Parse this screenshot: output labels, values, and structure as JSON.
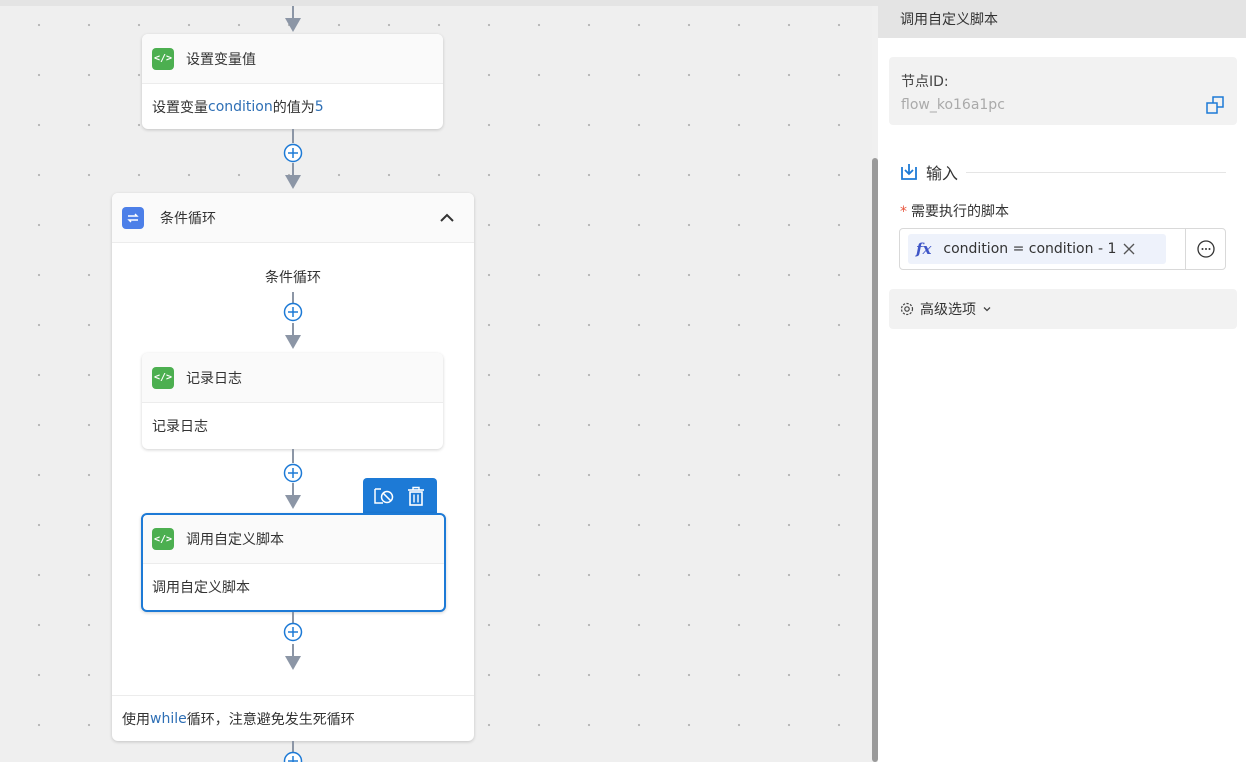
{
  "canvas": {
    "node_set_var": {
      "title": "设置变量值",
      "icon": "code-icon",
      "body_prefix": "设置变量 ",
      "body_var": "condition",
      "body_mid": " 的值为 ",
      "body_value": "5"
    },
    "loop": {
      "title": "条件循环",
      "icon": "loop-icon",
      "label": "条件循环",
      "footer_prefix": "使用 ",
      "footer_keyword": "while",
      "footer_suffix": " 循环，注意避免发生死循环"
    },
    "node_log": {
      "title": "记录日志",
      "icon": "code-icon",
      "body": "记录日志"
    },
    "node_script": {
      "title": "调用自定义脚本",
      "icon": "code-icon",
      "body": "调用自定义脚本"
    },
    "colors": {
      "accent": "#1d7ad6",
      "code_icon": "#4caf50",
      "loop_icon": "#4c7fe8",
      "highlight": "#2e6fb5"
    }
  },
  "panel": {
    "title": "调用自定义脚本",
    "node_id_label": "节点ID:",
    "node_id_value": "flow_ko16a1pc",
    "input_section": "输入",
    "script_label": "需要执行的脚本",
    "script_value": "condition = condition - 1",
    "fx_label": "fx",
    "advanced_label": "高级选项"
  }
}
